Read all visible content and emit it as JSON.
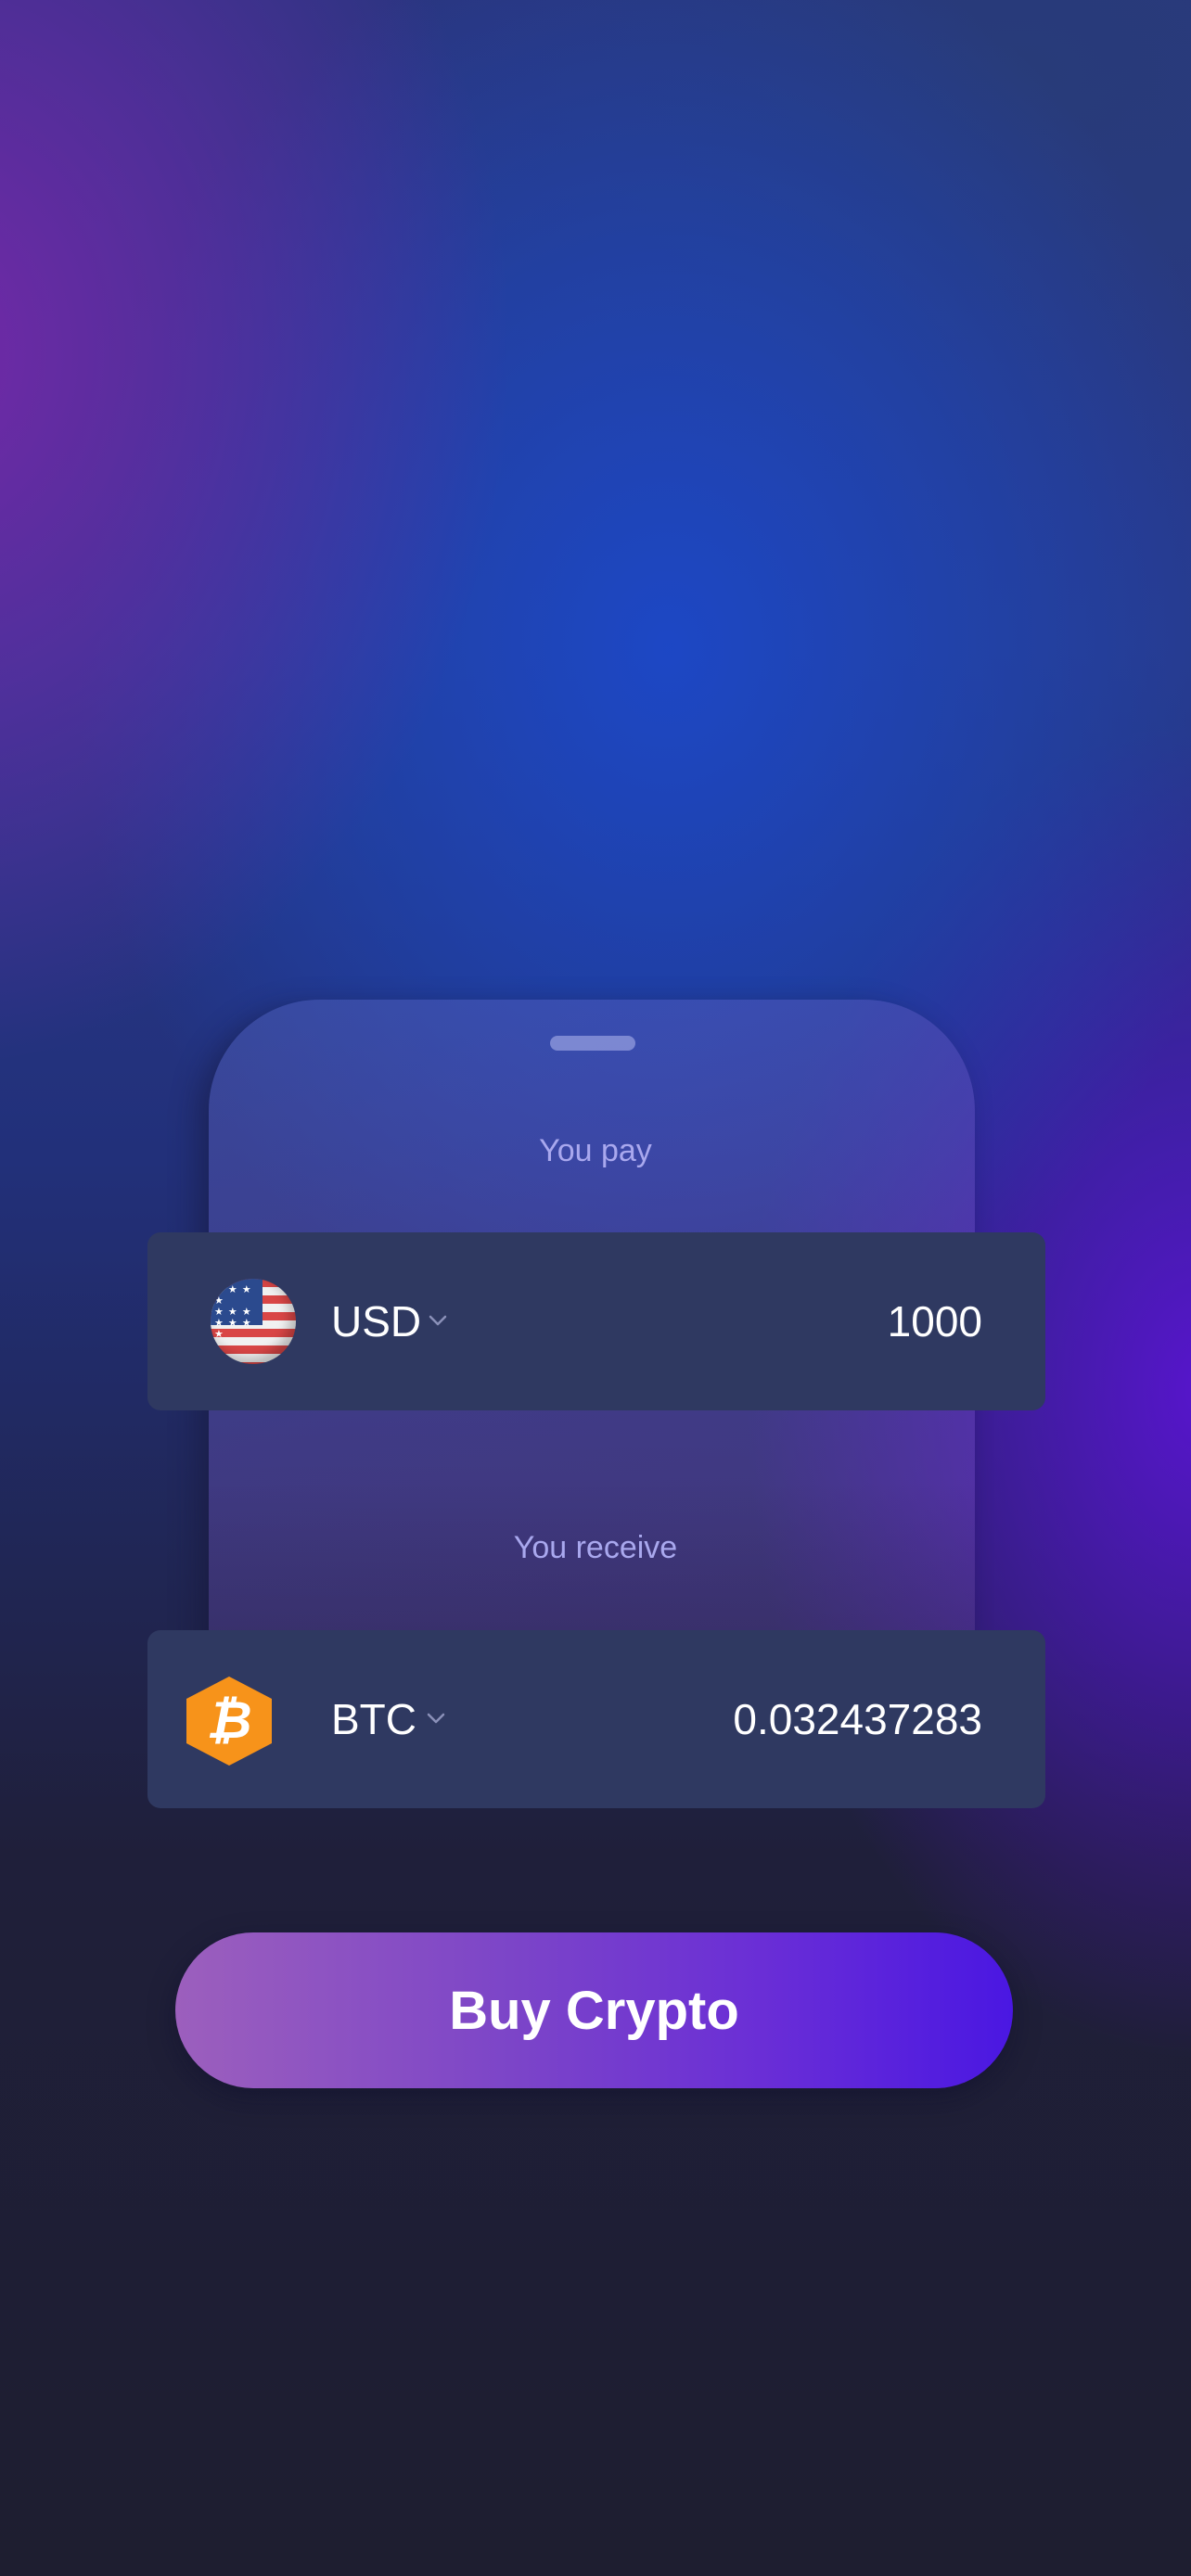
{
  "pay": {
    "label": "You pay",
    "currency": "USD",
    "currency_icon": "us-flag-icon",
    "amount": "1000"
  },
  "receive": {
    "label": "You receive",
    "currency": "BTC",
    "currency_icon": "bitcoin-icon",
    "amount": "0.032437283"
  },
  "buy_button": {
    "label": "Buy Crypto"
  },
  "colors": {
    "card": "#2f3961",
    "label": "#a9a8ee",
    "bitcoin": "#f7931a",
    "button_start": "#9c5fbd",
    "button_end": "#4a17e2"
  }
}
